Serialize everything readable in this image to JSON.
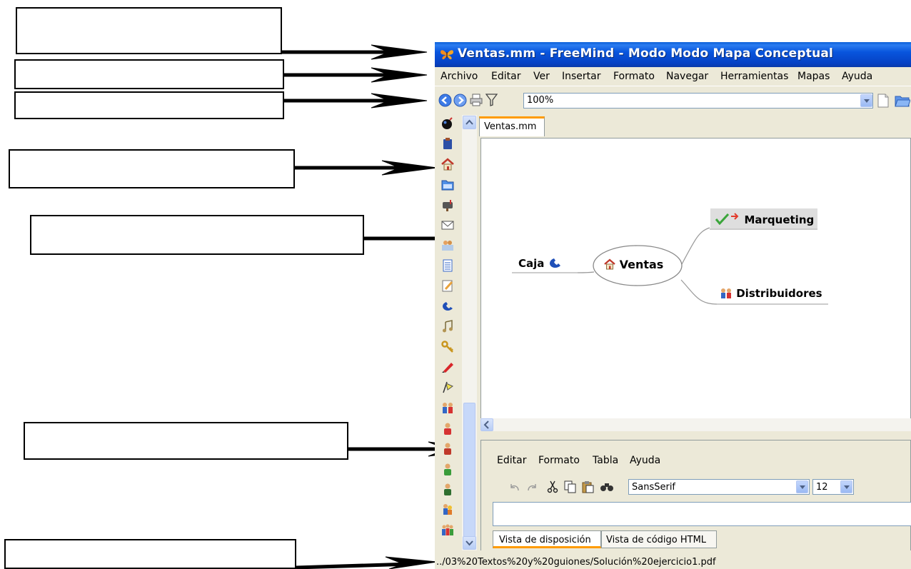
{
  "window": {
    "title": "Ventas.mm - FreeMind - Modo Modo Mapa Conceptual",
    "app_icon": "butterfly-icon"
  },
  "menu": [
    "Archivo",
    "Editar",
    "Ver",
    "Insertar",
    "Formato",
    "Navegar",
    "Herramientas",
    "Mapas",
    "Ayuda"
  ],
  "toolbar": {
    "zoom_value": "100%",
    "icons": [
      "back-icon",
      "forward-icon",
      "print-icon",
      "filter-icon",
      "new-document-icon",
      "open-folder-icon"
    ]
  },
  "icon_strip": [
    "bomb-icon",
    "clipboard-icon",
    "home-icon",
    "folder-icon",
    "mailbox-icon",
    "envelope-icon",
    "people-writing-icon",
    "list-icon",
    "pencil-icon",
    "phone-icon",
    "music-icon",
    "key-icon",
    "pen-icon",
    "flag-icon",
    "family-icon",
    "woman-icon",
    "man-red-icon",
    "man-green-icon",
    "man-dark-icon",
    "couple-icon",
    "group-icon"
  ],
  "tabs": [
    "Ventas.mm"
  ],
  "mindmap": {
    "root": {
      "label": "Ventas",
      "icon": "home-icon"
    },
    "children": [
      {
        "label": "Marqueting",
        "icons": [
          "checkmark-icon",
          "arrow-right-icon"
        ]
      },
      {
        "label": "Distribuidores",
        "icons": [
          "family-icon"
        ]
      },
      {
        "label": "Caja",
        "icons": [
          "phone-icon"
        ]
      }
    ]
  },
  "notes_editor": {
    "menu": [
      "Editar",
      "Formato",
      "Tabla",
      "Ayuda"
    ],
    "font_family": "SansSerif",
    "font_size": "12",
    "tabs": [
      "Vista de disposición",
      "Vista de código HTML"
    ]
  },
  "status": "../03%20Textos%20y%20guiones/Solución%20ejercicio1.pdf",
  "colors": {
    "title_bar": "#0a54d8",
    "tab_accent": "#ff9b00",
    "window_bg": "#ece9d8"
  }
}
